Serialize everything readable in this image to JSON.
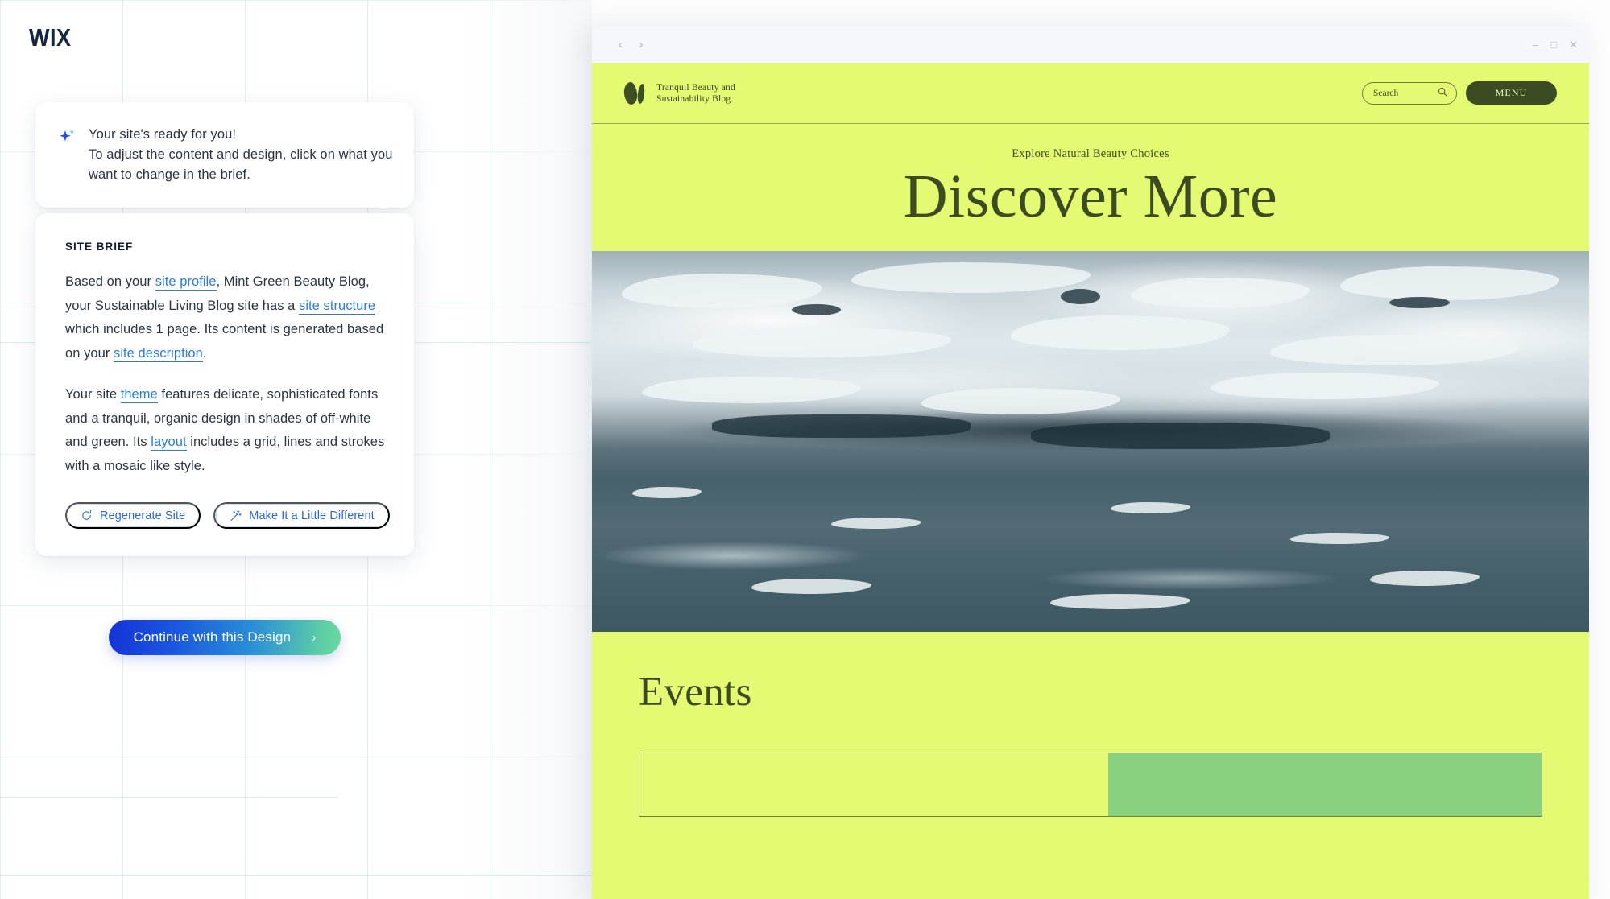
{
  "brand": {
    "logo_text": "WIX"
  },
  "notice": {
    "icon": "sparkle-icon",
    "line1": "Your site's ready for you!",
    "line2": "To adjust the content and design, click on what you want to change in the brief."
  },
  "brief": {
    "title": "SITE BRIEF",
    "paragraph1": {
      "t1": "Based on your ",
      "link1": "site profile",
      "t2": ", Mint Green Beauty Blog, your Sustainable Living Blog site has a ",
      "link2": "site structure",
      "t3": " which includes 1 page. Its content is generated based on your ",
      "link3": "site description",
      "t4": "."
    },
    "paragraph2": {
      "t1": "Your site ",
      "link1": "theme",
      "t2": " features delicate, sophisticated fonts and a tranquil, organic design in shades of off-white and green. Its ",
      "link2": "layout",
      "t3": " includes a grid, lines and strokes with a mosaic like style."
    },
    "buttons": [
      {
        "label": "Regenerate Site",
        "icon": "refresh-icon"
      },
      {
        "label": "Make It a Little Different",
        "icon": "magic-wand-icon"
      }
    ]
  },
  "cta": {
    "label": "Continue with this Design",
    "chevron": "›"
  },
  "preview": {
    "chrome": {
      "back": "‹",
      "forward": "›",
      "minimize": "–",
      "maximize": "□",
      "close": "✕"
    },
    "site": {
      "header": {
        "brand_line1": "Tranquil Beauty and",
        "brand_line2": "Sustainability Blog",
        "search_placeholder": "Search",
        "search_icon": "magnifier-icon",
        "menu_label": "MENU"
      },
      "hero": {
        "eyebrow": "Explore Natural Beauty Choices",
        "title": "Discover More"
      },
      "events": {
        "title": "Events"
      }
    }
  },
  "colors": {
    "site_accent": "#e4fa72",
    "site_dark_green": "#3c4b22",
    "link_blue": "#2a7cdd",
    "cta_gradient_start": "#1433d6",
    "cta_gradient_end": "#6ad9a0"
  }
}
